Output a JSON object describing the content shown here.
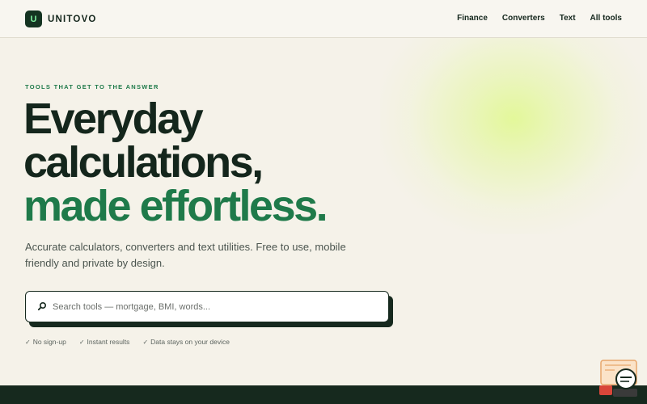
{
  "brand": {
    "mark": "U",
    "name": "UNITOVO"
  },
  "nav": {
    "items": [
      "Finance",
      "Converters",
      "Text",
      "All tools"
    ]
  },
  "hero": {
    "eyebrow": "TOOLS THAT GET TO THE ANSWER",
    "title_line1": "Everyday",
    "title_line2": "calculations,",
    "title_line3": "made effortless.",
    "lead": "Accurate calculators, converters and text utilities. Free to use, mobile friendly and private by design."
  },
  "search": {
    "placeholder": "Search tools — mortgage, BMI, words...",
    "value": "",
    "icon": "search-icon"
  },
  "perks": [
    "No sign-up",
    "Instant results",
    "Data stays on your device"
  ],
  "colors": {
    "accent": "#1f7a4a",
    "dark": "#14261c",
    "background": "#f5f2e9",
    "brand_mark": "#143321"
  }
}
